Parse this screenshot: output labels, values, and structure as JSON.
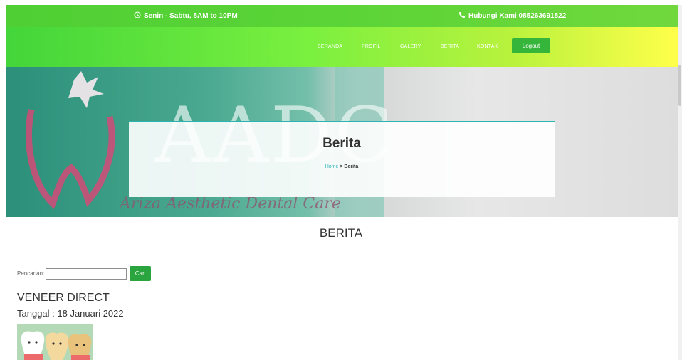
{
  "topbar": {
    "hours": "Senin - Sabtu, 8AM to 10PM",
    "phone": "Hubungi Kami 085263691822"
  },
  "nav": {
    "items": [
      {
        "label": "BERANDA"
      },
      {
        "label": "PROFIL"
      },
      {
        "label": "GALERY"
      },
      {
        "label": "BERITA"
      },
      {
        "label": "KONTAK"
      }
    ],
    "logout": "Logout"
  },
  "hero": {
    "logo_text": "AADC",
    "tagline": "Ariza Aesthetic Dental Care",
    "title": "Berita",
    "breadcrumb": {
      "home": "Home",
      "separator": ">",
      "current": "Berita"
    }
  },
  "section": {
    "heading": "BERITA"
  },
  "search": {
    "label": "Pencarian:",
    "value": "",
    "button": "Cari"
  },
  "news": [
    {
      "title": "VENEER DIRECT",
      "date": "Tanggal : 18 Januari 2022"
    }
  ],
  "colors": {
    "accent_green": "#2aa43e",
    "topbar_green": "#57d337",
    "teal": "#2cb5b0"
  },
  "icons": {
    "clock": "clock-icon",
    "phone": "phone-icon"
  }
}
